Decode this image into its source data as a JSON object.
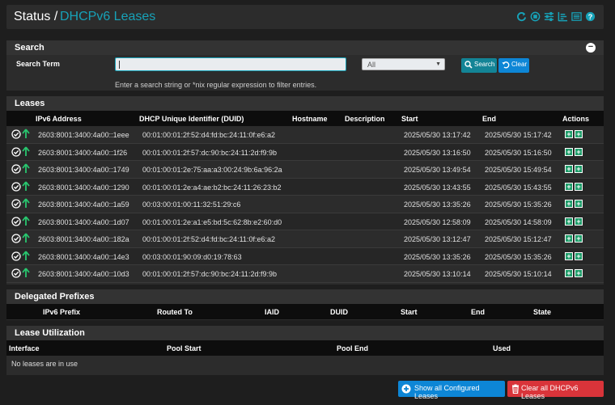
{
  "breadcrumb": {
    "section": "Status",
    "separator": "/",
    "page": "DHCPv6 Leases"
  },
  "header_icons": [
    "refresh-icon",
    "stop-icon",
    "settings-sliders-icon",
    "chart-icon",
    "list-icon",
    "help-icon"
  ],
  "search": {
    "title": "Search",
    "term_label": "Search Term",
    "input_value": "",
    "select_value": "All",
    "search_button": "Search",
    "clear_button": "Clear",
    "help_text": "Enter a search string or *nix regular expression to filter entries."
  },
  "leases": {
    "title": "Leases",
    "columns": [
      "IPv6 Address",
      "DHCP Unique Identifier (DUID)",
      "Hostname",
      "Description",
      "Start",
      "End",
      "Actions"
    ],
    "rows": [
      {
        "ip": "2603:8001:3400:4a00::1eee",
        "duid": "00:01:00:01:2f:52:d4:fd:bc:24:11:0f:e6:a2",
        "start": "2025/05/30 13:17:42",
        "end": "2025/05/30 15:17:42"
      },
      {
        "ip": "2603:8001:3400:4a00::1f26",
        "duid": "00:01:00:01:2f:57:dc:90:bc:24:11:2d:f9:9b",
        "start": "2025/05/30 13:16:50",
        "end": "2025/05/30 15:16:50"
      },
      {
        "ip": "2603:8001:3400:4a00::1749",
        "duid": "00:01:00:01:2e:75:aa:a3:00:24:9b:6a:96:2a",
        "start": "2025/05/30 13:49:54",
        "end": "2025/05/30 15:49:54"
      },
      {
        "ip": "2603:8001:3400:4a00::1290",
        "duid": "00:01:00:01:2e:a4:ae:b2:bc:24:11:26:23:b2",
        "start": "2025/05/30 13:43:55",
        "end": "2025/05/30 15:43:55"
      },
      {
        "ip": "2603:8001:3400:4a00::1a59",
        "duid": "00:03:00:01:00:11:32:51:29:c6",
        "start": "2025/05/30 13:35:26",
        "end": "2025/05/30 15:35:26"
      },
      {
        "ip": "2603:8001:3400:4a00::1d07",
        "duid": "00:01:00:01:2e:a1:e5:bd:5c:62:8b:e2:60:d0",
        "start": "2025/05/30 12:58:09",
        "end": "2025/05/30 14:58:09"
      },
      {
        "ip": "2603:8001:3400:4a00::182a",
        "duid": "00:01:00:01:2f:52:d4:fd:bc:24:11:0f:e6:a2",
        "start": "2025/05/30 13:12:47",
        "end": "2025/05/30 15:12:47"
      },
      {
        "ip": "2603:8001:3400:4a00::14e3",
        "duid": "00:03:00:01:90:09:d0:19:78:63",
        "start": "2025/05/30 13:35:26",
        "end": "2025/05/30 15:35:26"
      },
      {
        "ip": "2603:8001:3400:4a00::10d3",
        "duid": "00:01:00:01:2f:57:dc:90:bc:24:11:2d:f9:9b",
        "start": "2025/05/30 13:10:14",
        "end": "2025/05/30 15:10:14"
      }
    ]
  },
  "prefixes": {
    "title": "Delegated Prefixes",
    "columns": [
      "IPv6 Prefix",
      "Routed To",
      "IAID",
      "DUID",
      "Start",
      "End",
      "State"
    ]
  },
  "utilization": {
    "title": "Lease Utilization",
    "columns": [
      "Interface",
      "Pool Start",
      "Pool End",
      "Used"
    ],
    "empty_text": "No leases are in use"
  },
  "footer": {
    "show_button": "Show all Configured Leases",
    "clear_button": "Clear all DHCPv6 Leases"
  },
  "colors": {
    "accent": "#17a2b8",
    "action_green": "#1f9d6a",
    "primary": "#0d86d6",
    "danger": "#d9343a"
  }
}
